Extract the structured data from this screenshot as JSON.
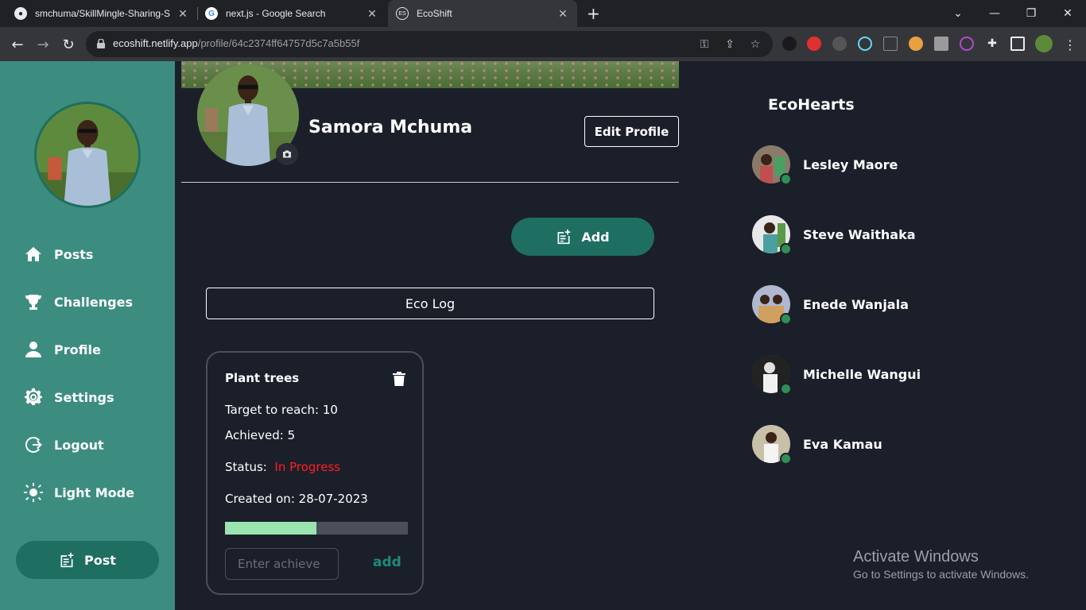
{
  "browser": {
    "tabs": [
      {
        "title": "smchuma/SkillMingle-Sharing-S",
        "favicon": "github-icon"
      },
      {
        "title": "next.js - Google Search",
        "favicon": "google-icon"
      },
      {
        "title": "EcoShift",
        "favicon": "ecoshift-icon"
      }
    ],
    "url_host": "ecoshift.netlify.app",
    "url_path": "/profile/64c2374ff64757d5c7a5b55f"
  },
  "sidebar": {
    "items": [
      {
        "label": "Posts",
        "icon": "home-icon"
      },
      {
        "label": "Challenges",
        "icon": "trophy-icon"
      },
      {
        "label": "Profile",
        "icon": "user-icon"
      },
      {
        "label": "Settings",
        "icon": "gear-icon"
      },
      {
        "label": "Logout",
        "icon": "logout-icon"
      },
      {
        "label": "Light Mode",
        "icon": "sun-icon"
      }
    ],
    "post_label": "Post"
  },
  "profile": {
    "name": "Samora Mchuma",
    "edit_label": "Edit Profile"
  },
  "main": {
    "add_label": "Add",
    "ecolog_label": "Eco Log"
  },
  "card": {
    "title": "Plant trees",
    "target_label": "Target to reach:",
    "target_value": "10",
    "achieved_label": "Achieved:",
    "achieved_value": "5",
    "status_label": "Status:",
    "status_value": "In Progress",
    "created_label": "Created on:",
    "created_value": "28-07-2023",
    "progress": 0.5,
    "input_placeholder": "Enter achieve",
    "add_label": "add"
  },
  "ecohearts": {
    "title": "EcoHearts",
    "friends": [
      {
        "name": "Lesley Maore"
      },
      {
        "name": "Steve Waithaka"
      },
      {
        "name": "Enede Wanjala"
      },
      {
        "name": "Michelle Wangui"
      },
      {
        "name": "Eva Kamau"
      }
    ]
  },
  "watermark": {
    "line1": "Activate Windows",
    "line2": "Go to Settings to activate Windows."
  },
  "colors": {
    "sidebar": "#3c8d80",
    "accent": "#1e6e62",
    "background": "#1b1f2a",
    "status": "#ff2020",
    "progress_fill": "#9be4b0"
  }
}
